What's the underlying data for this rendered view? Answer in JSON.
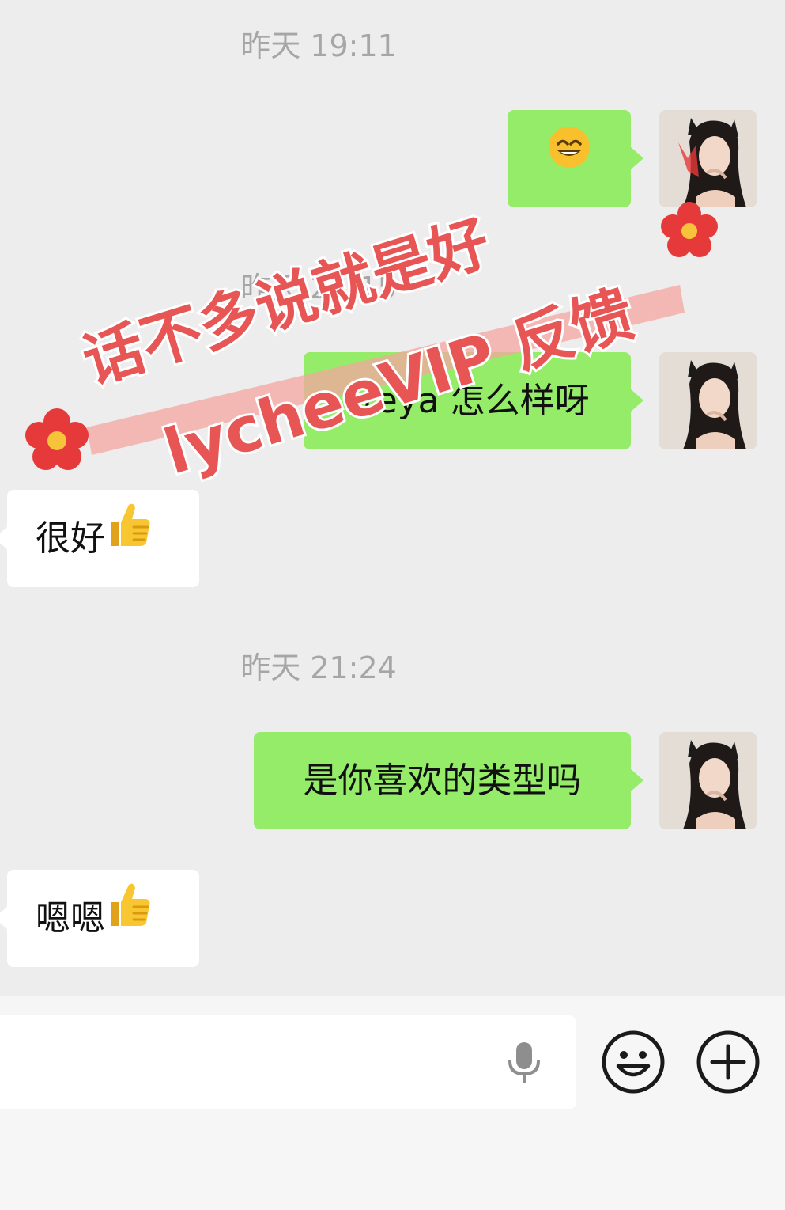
{
  "messages": [
    {
      "type": "timestamp",
      "text": "昨天 19:11"
    },
    {
      "type": "sent",
      "text": "😄",
      "avatar": "user-avatar"
    },
    {
      "type": "timestamp",
      "text": "昨天 21:15"
    },
    {
      "type": "sent",
      "text": "Freya 怎么样呀",
      "avatar": "user-avatar"
    },
    {
      "type": "received",
      "text": "很好",
      "emoji": "thumbs-up-icon"
    },
    {
      "type": "timestamp",
      "text": "昨天 21:24"
    },
    {
      "type": "sent",
      "text": "是你喜欢的类型吗",
      "avatar": "user-avatar"
    },
    {
      "type": "received",
      "text": "嗯嗯",
      "emoji": "thumbs-up-icon"
    }
  ],
  "watermark": {
    "line1": "话不多说就是好",
    "line2": "lycheeVIP 反馈"
  },
  "input_bar": {
    "icons": [
      "microphone-icon",
      "emoji-icon",
      "plus-icon"
    ]
  },
  "colors": {
    "background": "#ededed",
    "sent_bubble": "#95ec69",
    "received_bubble": "#ffffff",
    "timestamp": "#a6a6a6",
    "watermark": "#e85555"
  }
}
